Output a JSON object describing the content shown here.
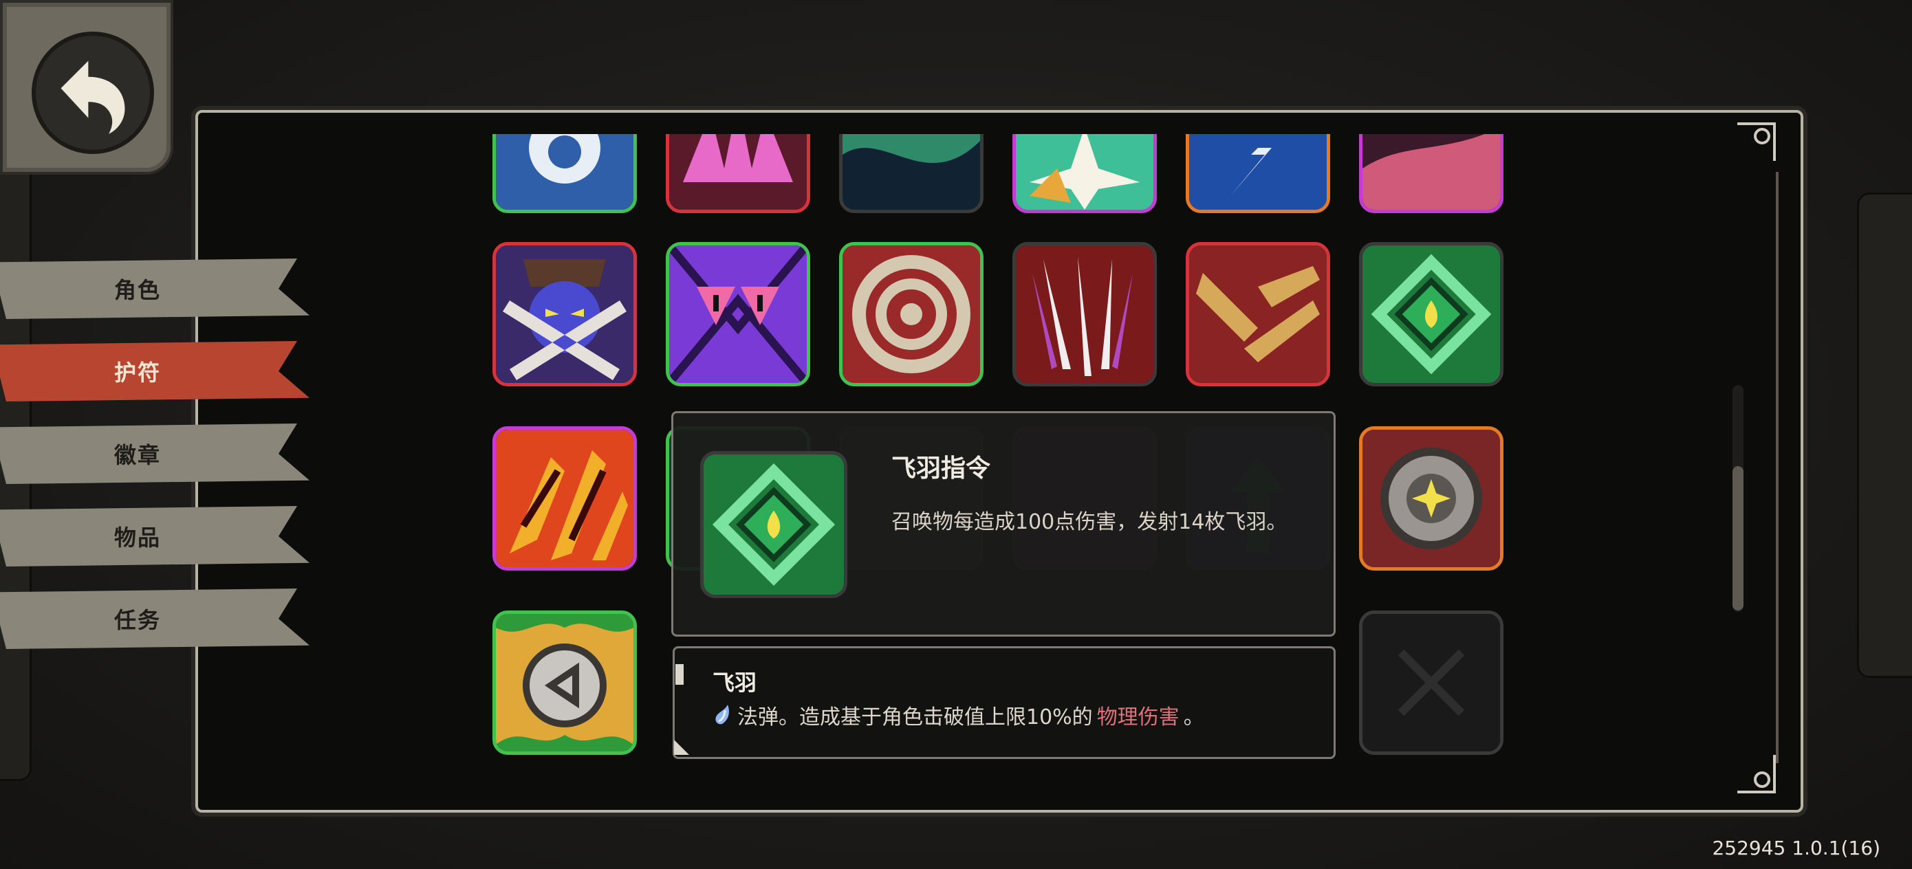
{
  "sidebar": {
    "tabs": [
      {
        "label": "角色",
        "active": false
      },
      {
        "label": "护符",
        "active": true
      },
      {
        "label": "徽章",
        "active": false
      },
      {
        "label": "物品",
        "active": false
      },
      {
        "label": "任务",
        "active": false
      }
    ]
  },
  "tooltip": {
    "title": "飞羽指令",
    "description": "召唤物每造成100点伤害，发射14枚飞羽。",
    "sub_title": "飞羽",
    "sub_text_before": "法弹。造成基于角色击破值上限10%的",
    "sub_text_highlight": "物理伤害",
    "sub_text_after": "。",
    "highlight_color": "#e2707a"
  },
  "version": "252945 1.0.1(16)",
  "colors": {
    "active_tab": "#b8452f",
    "inactive_tab": "#8a877a",
    "rarity_green": "#3fc24e",
    "rarity_red": "#d8333b",
    "rarity_purple": "#c63ad6",
    "rarity_orange": "#e47a26"
  },
  "icons": {
    "back": "back-arrow-icon",
    "close": "close-x-icon"
  }
}
